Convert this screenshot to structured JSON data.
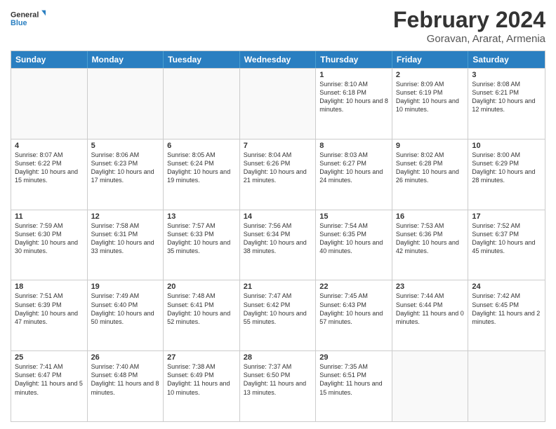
{
  "logo": {
    "line1": "General",
    "line2": "Blue"
  },
  "title": "February 2024",
  "subtitle": "Goravan, Ararat, Armenia",
  "weekdays": [
    "Sunday",
    "Monday",
    "Tuesday",
    "Wednesday",
    "Thursday",
    "Friday",
    "Saturday"
  ],
  "rows": [
    [
      {
        "day": "",
        "info": "",
        "empty": true
      },
      {
        "day": "",
        "info": "",
        "empty": true
      },
      {
        "day": "",
        "info": "",
        "empty": true
      },
      {
        "day": "",
        "info": "",
        "empty": true
      },
      {
        "day": "1",
        "info": "Sunrise: 8:10 AM\nSunset: 6:18 PM\nDaylight: 10 hours and 8 minutes."
      },
      {
        "day": "2",
        "info": "Sunrise: 8:09 AM\nSunset: 6:19 PM\nDaylight: 10 hours and 10 minutes."
      },
      {
        "day": "3",
        "info": "Sunrise: 8:08 AM\nSunset: 6:21 PM\nDaylight: 10 hours and 12 minutes."
      }
    ],
    [
      {
        "day": "4",
        "info": "Sunrise: 8:07 AM\nSunset: 6:22 PM\nDaylight: 10 hours and 15 minutes."
      },
      {
        "day": "5",
        "info": "Sunrise: 8:06 AM\nSunset: 6:23 PM\nDaylight: 10 hours and 17 minutes."
      },
      {
        "day": "6",
        "info": "Sunrise: 8:05 AM\nSunset: 6:24 PM\nDaylight: 10 hours and 19 minutes."
      },
      {
        "day": "7",
        "info": "Sunrise: 8:04 AM\nSunset: 6:26 PM\nDaylight: 10 hours and 21 minutes."
      },
      {
        "day": "8",
        "info": "Sunrise: 8:03 AM\nSunset: 6:27 PM\nDaylight: 10 hours and 24 minutes."
      },
      {
        "day": "9",
        "info": "Sunrise: 8:02 AM\nSunset: 6:28 PM\nDaylight: 10 hours and 26 minutes."
      },
      {
        "day": "10",
        "info": "Sunrise: 8:00 AM\nSunset: 6:29 PM\nDaylight: 10 hours and 28 minutes."
      }
    ],
    [
      {
        "day": "11",
        "info": "Sunrise: 7:59 AM\nSunset: 6:30 PM\nDaylight: 10 hours and 30 minutes."
      },
      {
        "day": "12",
        "info": "Sunrise: 7:58 AM\nSunset: 6:31 PM\nDaylight: 10 hours and 33 minutes."
      },
      {
        "day": "13",
        "info": "Sunrise: 7:57 AM\nSunset: 6:33 PM\nDaylight: 10 hours and 35 minutes."
      },
      {
        "day": "14",
        "info": "Sunrise: 7:56 AM\nSunset: 6:34 PM\nDaylight: 10 hours and 38 minutes."
      },
      {
        "day": "15",
        "info": "Sunrise: 7:54 AM\nSunset: 6:35 PM\nDaylight: 10 hours and 40 minutes."
      },
      {
        "day": "16",
        "info": "Sunrise: 7:53 AM\nSunset: 6:36 PM\nDaylight: 10 hours and 42 minutes."
      },
      {
        "day": "17",
        "info": "Sunrise: 7:52 AM\nSunset: 6:37 PM\nDaylight: 10 hours and 45 minutes."
      }
    ],
    [
      {
        "day": "18",
        "info": "Sunrise: 7:51 AM\nSunset: 6:39 PM\nDaylight: 10 hours and 47 minutes."
      },
      {
        "day": "19",
        "info": "Sunrise: 7:49 AM\nSunset: 6:40 PM\nDaylight: 10 hours and 50 minutes."
      },
      {
        "day": "20",
        "info": "Sunrise: 7:48 AM\nSunset: 6:41 PM\nDaylight: 10 hours and 52 minutes."
      },
      {
        "day": "21",
        "info": "Sunrise: 7:47 AM\nSunset: 6:42 PM\nDaylight: 10 hours and 55 minutes."
      },
      {
        "day": "22",
        "info": "Sunrise: 7:45 AM\nSunset: 6:43 PM\nDaylight: 10 hours and 57 minutes."
      },
      {
        "day": "23",
        "info": "Sunrise: 7:44 AM\nSunset: 6:44 PM\nDaylight: 11 hours and 0 minutes."
      },
      {
        "day": "24",
        "info": "Sunrise: 7:42 AM\nSunset: 6:45 PM\nDaylight: 11 hours and 2 minutes."
      }
    ],
    [
      {
        "day": "25",
        "info": "Sunrise: 7:41 AM\nSunset: 6:47 PM\nDaylight: 11 hours and 5 minutes."
      },
      {
        "day": "26",
        "info": "Sunrise: 7:40 AM\nSunset: 6:48 PM\nDaylight: 11 hours and 8 minutes."
      },
      {
        "day": "27",
        "info": "Sunrise: 7:38 AM\nSunset: 6:49 PM\nDaylight: 11 hours and 10 minutes."
      },
      {
        "day": "28",
        "info": "Sunrise: 7:37 AM\nSunset: 6:50 PM\nDaylight: 11 hours and 13 minutes."
      },
      {
        "day": "29",
        "info": "Sunrise: 7:35 AM\nSunset: 6:51 PM\nDaylight: 11 hours and 15 minutes."
      },
      {
        "day": "",
        "info": "",
        "empty": true
      },
      {
        "day": "",
        "info": "",
        "empty": true
      }
    ]
  ]
}
